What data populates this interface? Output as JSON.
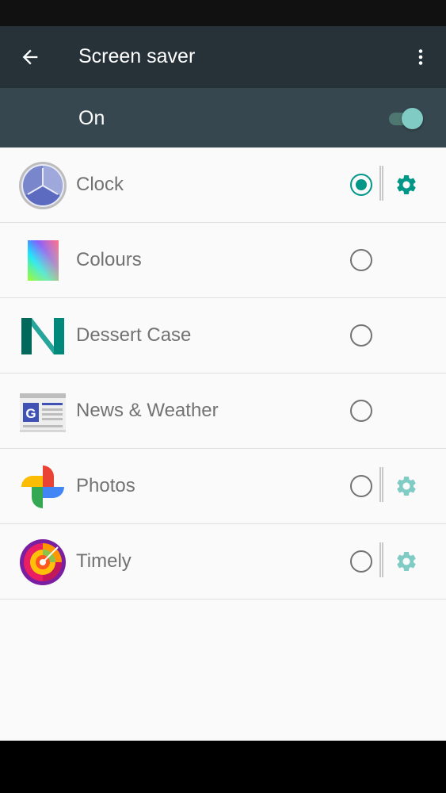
{
  "app_bar": {
    "title": "Screen saver"
  },
  "master_switch": {
    "label": "On",
    "state": "on"
  },
  "colors": {
    "accent": "#009688",
    "gear_active": "#009688",
    "gear_inactive": "#80cbc4",
    "app_bar": "#263238",
    "switch_bar": "#37474f"
  },
  "items": [
    {
      "label": "Clock",
      "icon": "clock-icon",
      "selected": true,
      "has_settings": true
    },
    {
      "label": "Colours",
      "icon": "colours-icon",
      "selected": false,
      "has_settings": false
    },
    {
      "label": "Dessert Case",
      "icon": "dessert-case-icon",
      "selected": false,
      "has_settings": false
    },
    {
      "label": "News & Weather",
      "icon": "news-weather-icon",
      "selected": false,
      "has_settings": false
    },
    {
      "label": "Photos",
      "icon": "photos-icon",
      "selected": false,
      "has_settings": true
    },
    {
      "label": "Timely",
      "icon": "timely-icon",
      "selected": false,
      "has_settings": true
    }
  ]
}
